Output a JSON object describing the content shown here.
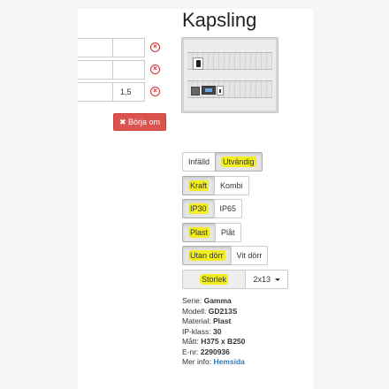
{
  "table": {
    "rows": [
      {
        "value": ""
      },
      {
        "value": ""
      },
      {
        "value": "1,5"
      }
    ],
    "remove_icon": "remove-icon"
  },
  "restart_button": {
    "label": "Börja om",
    "icon": "times-icon"
  },
  "product": {
    "title": "Kapsling",
    "image_alt": "cabinet-image"
  },
  "options": {
    "mounting": [
      "Infälld",
      "Utvändig"
    ],
    "type": [
      "Kraft",
      "Kombi"
    ],
    "ip": [
      "IP30",
      "IP65"
    ],
    "door_material": [
      "Plast",
      "Plåt"
    ],
    "door": [
      "Utan dörr",
      "Vit dörr"
    ],
    "selected": {
      "mounting": "Utvändig",
      "type": "Kraft",
      "ip": "IP30",
      "door_material": "Plast",
      "door": "Utan dörr"
    }
  },
  "size": {
    "label": "Storlek",
    "value": "2x13"
  },
  "specs": {
    "serie_label": "Serie:",
    "serie": "Gamma",
    "modell_label": "Modell:",
    "modell": "GD213S",
    "material_label": "Material:",
    "material": "Plast",
    "ip_label": "IP-klass:",
    "ip": "30",
    "matt_label": "Mått:",
    "matt": "H375 x B250",
    "enr_label": "E-nr:",
    "enr": "2290936",
    "info_label": "Mer info:",
    "info_link": "Hemsida"
  },
  "colors": {
    "highlight": "#f2ed1f",
    "danger": "#d9534f",
    "link": "#337ab7"
  }
}
